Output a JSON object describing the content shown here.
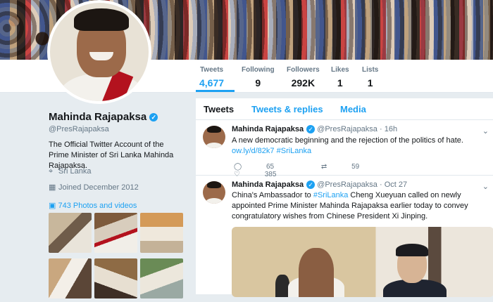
{
  "profile": {
    "name": "Mahinda Rajapaksa",
    "handle": "@PresRajapaksa",
    "bio": "The Official Twitter Account of the Prime Minister of Sri Lanka Mahinda Rajapaksa.",
    "location": "Sri Lanka",
    "joined": "Joined December 2012",
    "photos_link": "743 Photos and videos"
  },
  "stats": [
    {
      "label": "Tweets",
      "value": "4,677"
    },
    {
      "label": "Following",
      "value": "9"
    },
    {
      "label": "Followers",
      "value": "292K"
    },
    {
      "label": "Likes",
      "value": "1"
    },
    {
      "label": "Lists",
      "value": "1"
    }
  ],
  "tabs": [
    "Tweets",
    "Tweets & replies",
    "Media"
  ],
  "tweets": [
    {
      "author": "Mahinda Rajapaksa",
      "handle": "@PresRajapaksa",
      "time": "· 16h",
      "text": "A new democratic beginning and the rejection of the politics of hate.",
      "link": "ow.ly/d/82k7",
      "hashtag": "#SriLanka",
      "replies": "65",
      "retweets": "59",
      "likes": "385"
    },
    {
      "author": "Mahinda Rajapaksa",
      "handle": "@PresRajapaksa",
      "time": "· Oct 27",
      "text_before": "China's Ambassador to ",
      "hashtag": "#SriLanka",
      "text_after": " Cheng Xueyuan called on newly appointed Prime Minister Mahinda Rajapaksa earlier today to convey congratulatory wishes from Chinese President Xi Jinping."
    }
  ],
  "colors": {
    "accent": "#1da1f2",
    "text": "#14171a",
    "muted": "#657786",
    "background": "#e6ecf0"
  }
}
